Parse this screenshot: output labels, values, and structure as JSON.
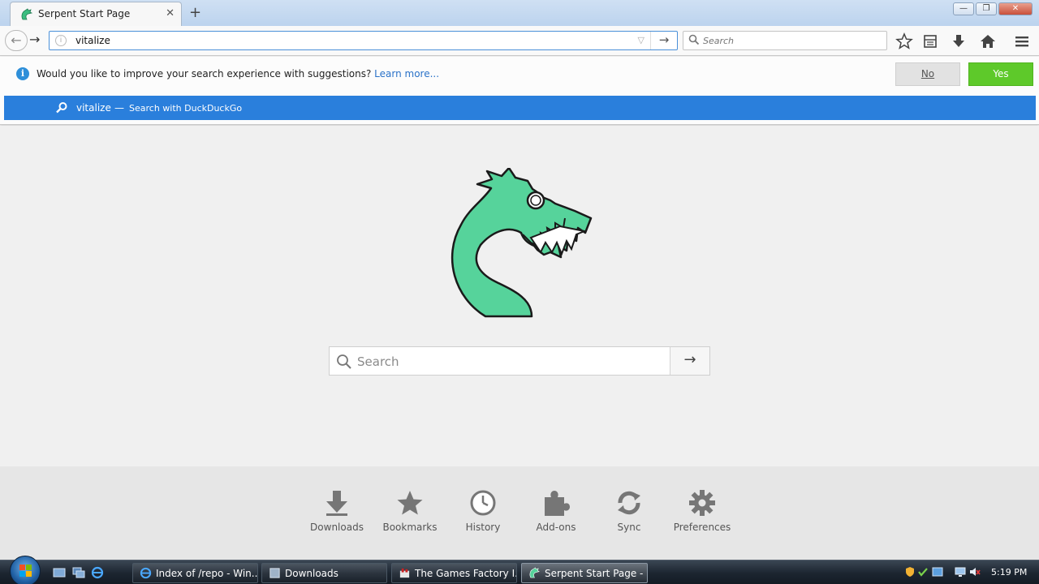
{
  "browser": {
    "tab_title": "Serpent Start Page",
    "new_tab_symbol": "+",
    "tab_close_symbol": "✕",
    "window_buttons": {
      "minimize": "—",
      "maximize": "❐",
      "close": "✕"
    }
  },
  "navbar": {
    "url_value": "vitalize",
    "search_placeholder": "Search",
    "back_symbol": "←",
    "forward_symbol": "→",
    "go_symbol": "→",
    "dropdown_symbol": "▽",
    "info_symbol": "i",
    "tools": [
      "bookmark-star-icon",
      "library-icon",
      "downloads-arrow-icon",
      "home-icon",
      "menu-icon"
    ]
  },
  "suggest": {
    "info_symbol": "i",
    "question": "Would you like to improve your search experience with suggestions?",
    "learn_more": "Learn more...",
    "no_label": "No",
    "yes_label": "Yes",
    "term": "vitalize",
    "separator": "—",
    "engine_text": "Search with DuckDuckGo"
  },
  "content": {
    "search_placeholder": "Search",
    "search_go_symbol": "→",
    "launchers": [
      {
        "label": "Downloads",
        "icon": "download-arrow-icon"
      },
      {
        "label": "Bookmarks",
        "icon": "star-icon"
      },
      {
        "label": "History",
        "icon": "clock-icon"
      },
      {
        "label": "Add-ons",
        "icon": "puzzle-icon"
      },
      {
        "label": "Sync",
        "icon": "sync-icon"
      },
      {
        "label": "Preferences",
        "icon": "gear-icon"
      }
    ]
  },
  "taskbar": {
    "tasks": [
      {
        "label": "Index of /repo - Win...",
        "icon": "ie-icon",
        "active": false
      },
      {
        "label": "Downloads",
        "icon": "folder-icon",
        "active": false
      },
      {
        "label": "The Games Factory I...",
        "icon": "games-factory-icon",
        "active": false
      },
      {
        "label": "Serpent Start Page - ...",
        "icon": "serpent-icon",
        "active": true
      }
    ],
    "clock": "5:19 PM"
  },
  "colors": {
    "accent_blue": "#2a7fdc",
    "yes_green": "#5ec92a",
    "serpent_green": "#4fd197"
  }
}
